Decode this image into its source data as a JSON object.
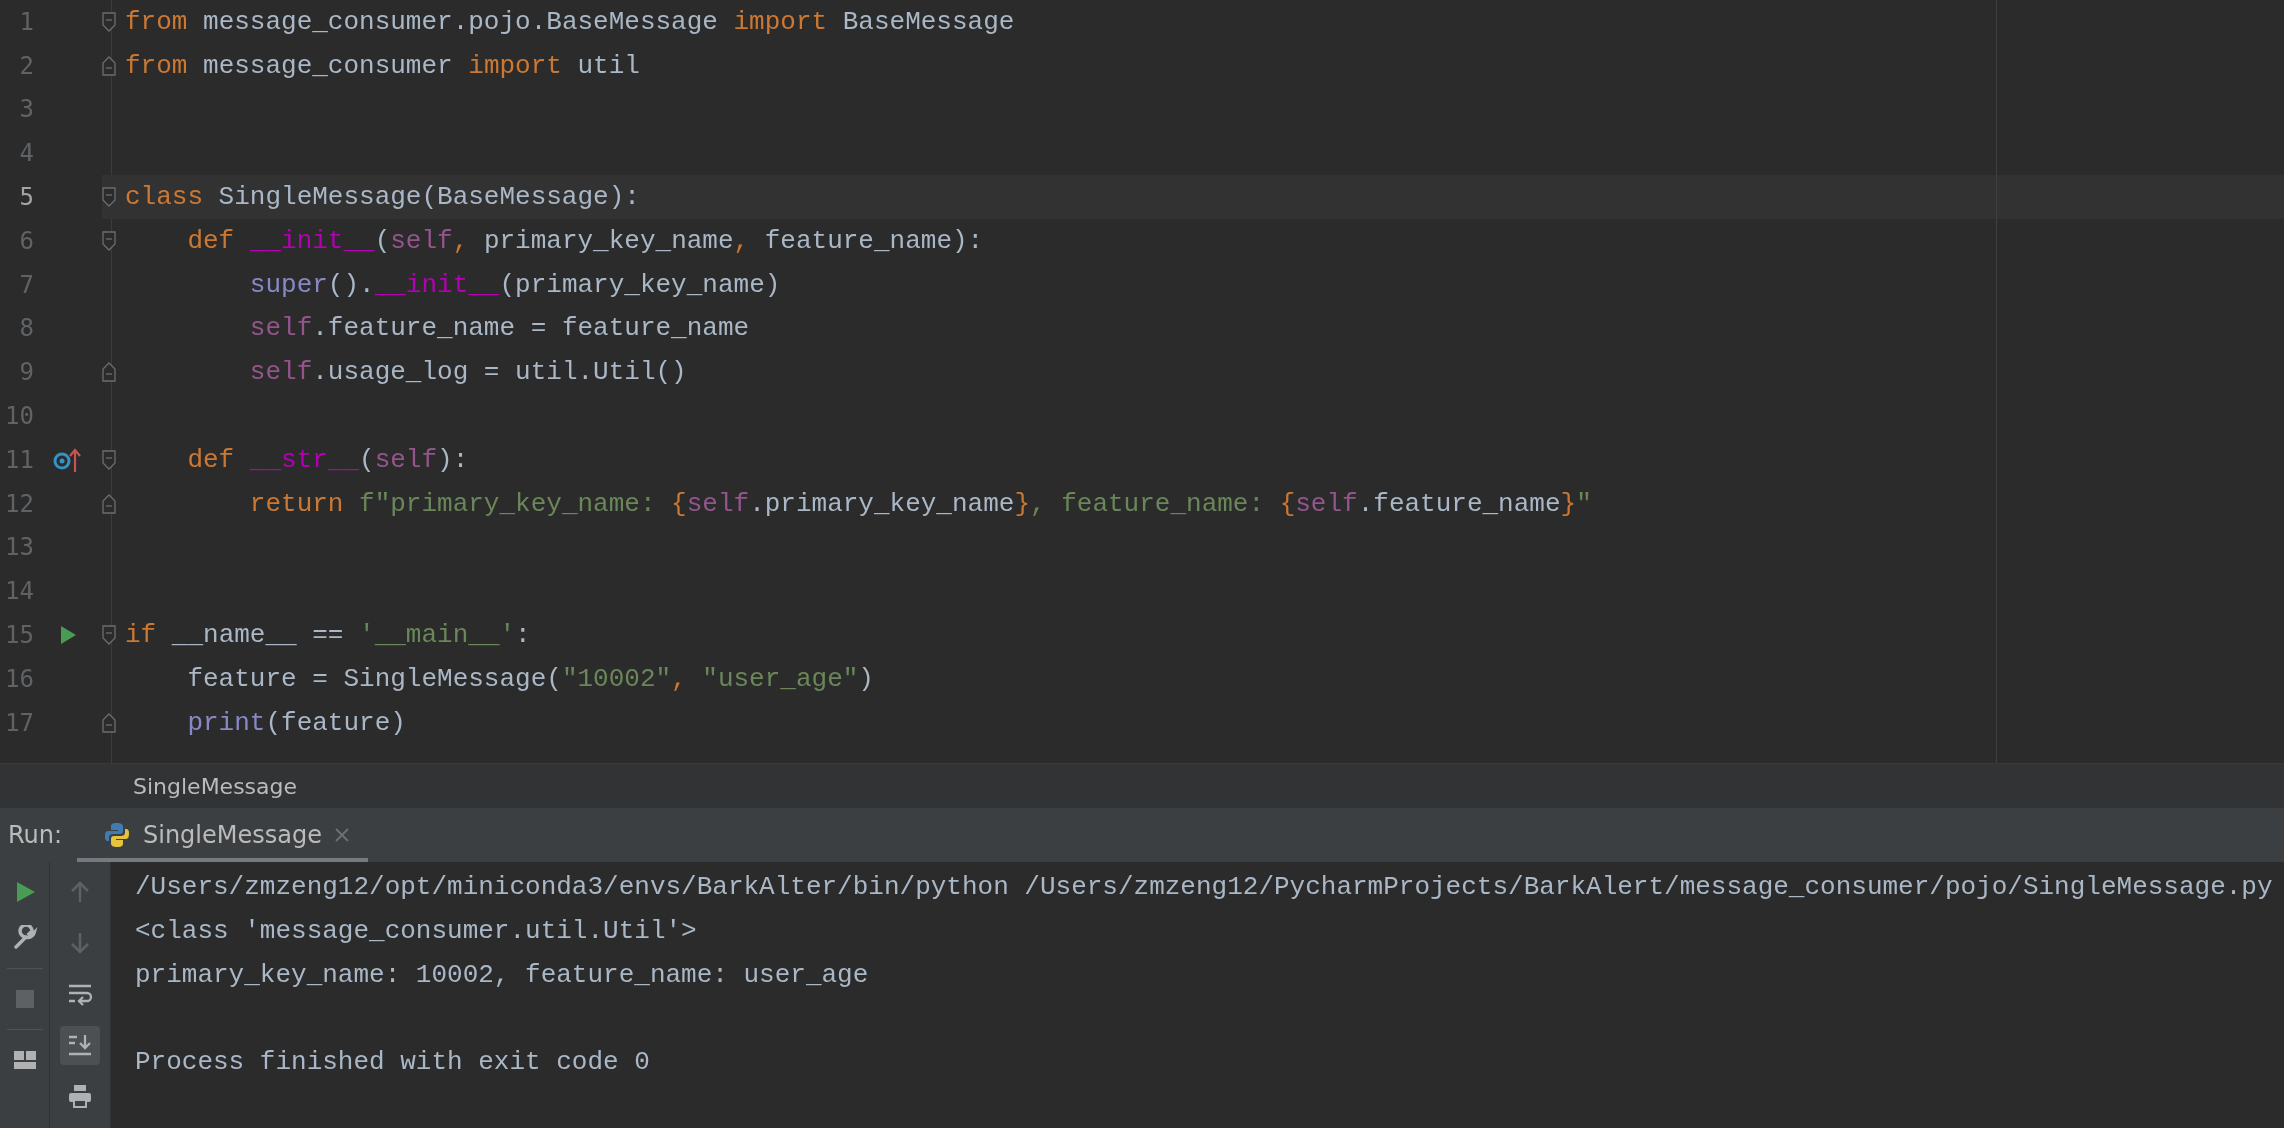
{
  "editor": {
    "lines": [
      {
        "number": "1",
        "current": false,
        "fold": {
          "kind": "start"
        },
        "tokens": [
          {
            "text": "from",
            "kind": "kw"
          },
          {
            "text": " message_consumer.pojo.BaseMessage ",
            "kind": "p"
          },
          {
            "text": "import",
            "kind": "kw"
          },
          {
            "text": " BaseMessage",
            "kind": "p"
          }
        ]
      },
      {
        "number": "2",
        "current": false,
        "fold": {
          "kind": "end"
        },
        "tokens": [
          {
            "text": "from",
            "kind": "kw"
          },
          {
            "text": " message_consumer ",
            "kind": "p"
          },
          {
            "text": "import",
            "kind": "kw"
          },
          {
            "text": " util",
            "kind": "p"
          }
        ]
      },
      {
        "number": "3",
        "current": false
      },
      {
        "number": "4",
        "current": false
      },
      {
        "number": "5",
        "current": true,
        "fold": {
          "kind": "start"
        },
        "tokens": [
          {
            "text": "class",
            "kind": "kw"
          },
          {
            "text": " SingleMessage(BaseMessage):",
            "kind": "p"
          }
        ]
      },
      {
        "number": "6",
        "current": false,
        "fold": {
          "kind": "start"
        },
        "tokens": [
          {
            "text": "    def ",
            "kind": "kw"
          },
          {
            "text": "__init__",
            "kind": "magic"
          },
          {
            "text": "(",
            "kind": "p"
          },
          {
            "text": "self",
            "kind": "self"
          },
          {
            "text": ",",
            "kind": "kw"
          },
          {
            "text": " primary_key_name",
            "kind": "p"
          },
          {
            "text": ",",
            "kind": "kw"
          },
          {
            "text": " feature_name):",
            "kind": "p"
          }
        ]
      },
      {
        "number": "7",
        "current": false,
        "tokens": [
          {
            "text": "        super",
            "kind": "builtin"
          },
          {
            "text": "().",
            "kind": "p"
          },
          {
            "text": "__init__",
            "kind": "magic"
          },
          {
            "text": "(primary_key_name)",
            "kind": "p"
          }
        ]
      },
      {
        "number": "8",
        "current": false,
        "tokens": [
          {
            "text": "        self",
            "kind": "self"
          },
          {
            "text": ".feature_name = feature_name",
            "kind": "p"
          }
        ]
      },
      {
        "number": "9",
        "current": false,
        "fold": {
          "kind": "end"
        },
        "tokens": [
          {
            "text": "        self",
            "kind": "self"
          },
          {
            "text": ".usage_log = util.Util()",
            "kind": "p"
          }
        ]
      },
      {
        "number": "10",
        "current": false
      },
      {
        "number": "11",
        "current": false,
        "gutter": {
          "kind": "override"
        },
        "fold": {
          "kind": "start"
        },
        "tokens": [
          {
            "text": "    def ",
            "kind": "kw"
          },
          {
            "text": "__str__",
            "kind": "magic"
          },
          {
            "text": "(",
            "kind": "p"
          },
          {
            "text": "self",
            "kind": "self"
          },
          {
            "text": "):",
            "kind": "p"
          }
        ]
      },
      {
        "number": "12",
        "current": false,
        "fold": {
          "kind": "end"
        },
        "tokens": [
          {
            "text": "        return ",
            "kind": "kw"
          },
          {
            "text": "f\"primary_key_name: ",
            "kind": "str"
          },
          {
            "text": "{",
            "kind": "kw"
          },
          {
            "text": "self",
            "kind": "self"
          },
          {
            "text": ".primary_key_name",
            "kind": "p"
          },
          {
            "text": "}",
            "kind": "kw"
          },
          {
            "text": ", feature_name: ",
            "kind": "str"
          },
          {
            "text": "{",
            "kind": "kw"
          },
          {
            "text": "self",
            "kind": "self"
          },
          {
            "text": ".feature_name",
            "kind": "p"
          },
          {
            "text": "}",
            "kind": "kw"
          },
          {
            "text": "\"",
            "kind": "str"
          }
        ]
      },
      {
        "number": "13",
        "current": false
      },
      {
        "number": "14",
        "current": false
      },
      {
        "number": "15",
        "current": false,
        "gutter": {
          "kind": "run"
        },
        "fold": {
          "kind": "start"
        },
        "tokens": [
          {
            "text": "if",
            "kind": "kw"
          },
          {
            "text": " __name__ == ",
            "kind": "p"
          },
          {
            "text": "'__main__'",
            "kind": "str"
          },
          {
            "text": ":",
            "kind": "p"
          }
        ]
      },
      {
        "number": "16",
        "current": false,
        "tokens": [
          {
            "text": "    feature = SingleMessage(",
            "kind": "p"
          },
          {
            "text": "\"10002\"",
            "kind": "str"
          },
          {
            "text": ",",
            "kind": "kw"
          },
          {
            "text": " \"user_age\"",
            "kind": "str"
          },
          {
            "text": ")",
            "kind": "p"
          }
        ]
      },
      {
        "number": "17",
        "current": false,
        "fold": {
          "kind": "end"
        },
        "tokens": [
          {
            "text": "    print",
            "kind": "builtin"
          },
          {
            "text": "(feature)",
            "kind": "p"
          }
        ]
      }
    ]
  },
  "breadcrumb": "SingleMessage",
  "run_panel": {
    "label": "Run:",
    "tabs": [
      {
        "label": "SingleMessage",
        "selected": true
      }
    ],
    "toolbar_main": [
      {
        "kind": "run",
        "disabled": false
      },
      {
        "kind": "settings",
        "disabled": false
      },
      {
        "kind": "stop",
        "disabled": true
      },
      {
        "kind": "layout",
        "disabled": false
      }
    ],
    "toolbar_side": [
      {
        "kind": "up",
        "disabled": true,
        "selected": false
      },
      {
        "kind": "down",
        "disabled": true,
        "selected": false
      },
      {
        "kind": "wrap",
        "disabled": false,
        "selected": false
      },
      {
        "kind": "scroll-end",
        "disabled": false,
        "selected": true
      },
      {
        "kind": "print",
        "disabled": false,
        "selected": false
      }
    ],
    "output_lines": [
      "/Users/zmzeng12/opt/miniconda3/envs/BarkAlter/bin/python /Users/zmzeng12/PycharmProjects/BarkAlert/message_consumer/pojo/SingleMessage.py",
      "<class 'message_consumer.util.Util'>",
      "primary_key_name: 10002, feature_name: user_age"
    ],
    "exit_message": "Process finished with exit code 0"
  }
}
